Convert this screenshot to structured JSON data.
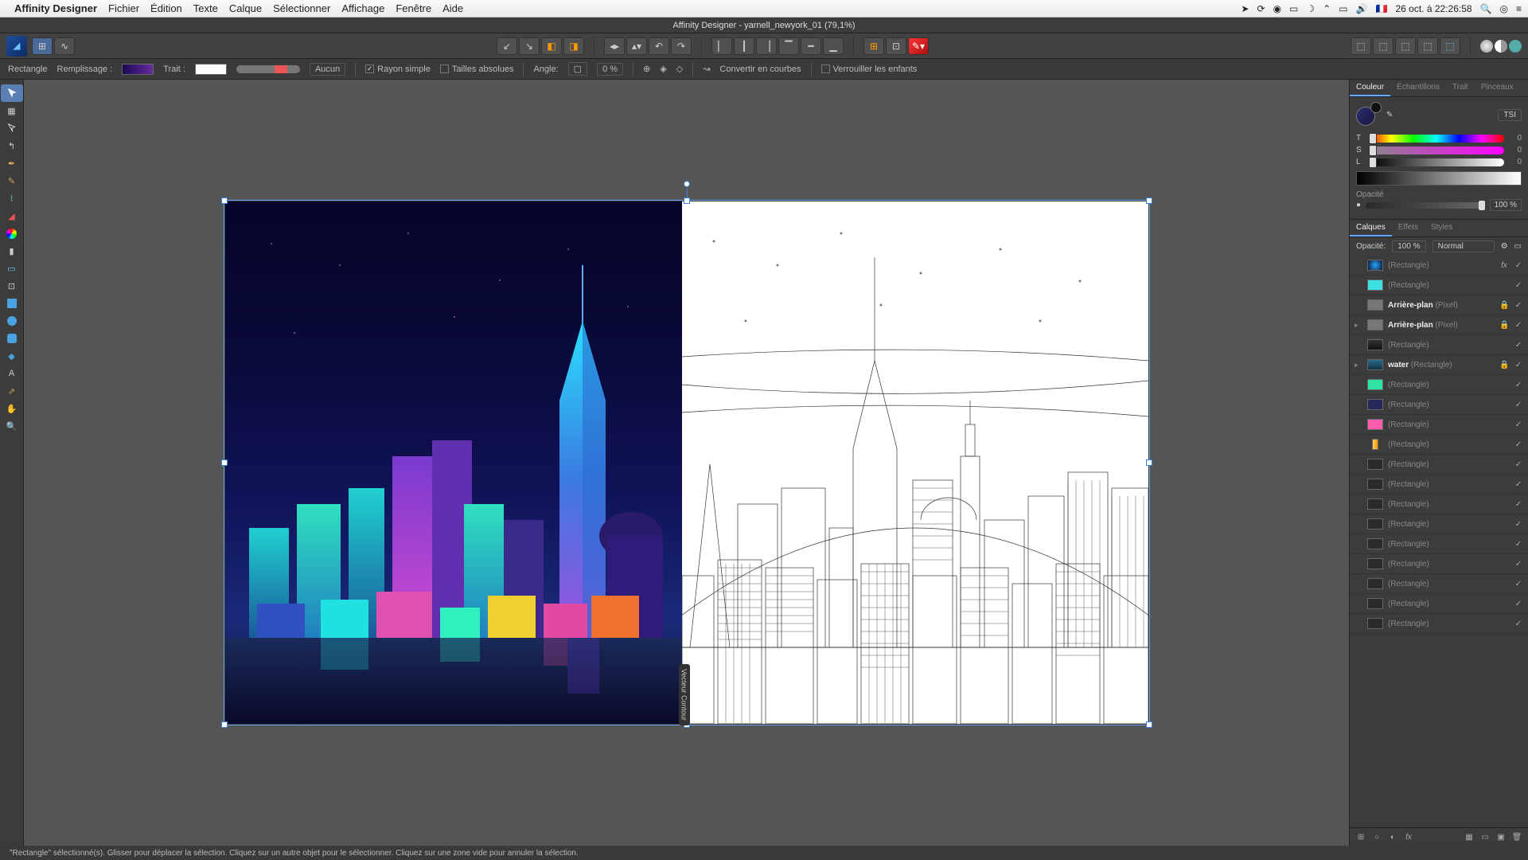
{
  "menubar": {
    "app": "Affinity Designer",
    "items": [
      "Fichier",
      "Édition",
      "Texte",
      "Calque",
      "Sélectionner",
      "Affichage",
      "Fenêtre",
      "Aide"
    ],
    "clock": "26 oct. à  22:26:58",
    "flag": "🇫🇷"
  },
  "doc_title": "Affinity Designer - yarnell_newyork_01 (79,1%)",
  "context": {
    "shape": "Rectangle",
    "fill_label": "Remplissage :",
    "stroke_label": "Trait :",
    "stroke_style": "Aucun",
    "simple_radius": "Rayon simple",
    "abs_sizes": "Tailles absolues",
    "angle_label": "Angle:",
    "angle_val": "0 %",
    "convert": "Convertir en courbes",
    "lock": "Verrouiller les enfants"
  },
  "color_panel": {
    "tabs": [
      "Couleur",
      "Échantillons",
      "Trait",
      "Pinceaux"
    ],
    "mode": "TSI",
    "t": "0",
    "s": "0",
    "l": "0",
    "opacity_label": "Opacité",
    "opacity": "100 %"
  },
  "layers_panel": {
    "tabs": [
      "Calques",
      "Effets",
      "Styles"
    ],
    "opacity_label": "Opacité:",
    "opacity_val": "100 %",
    "blend": "Normal"
  },
  "layers": [
    {
      "thumb": "radial-gradient(circle,#2af,#113)",
      "name": "(Rectangle)",
      "fx": true,
      "check": true
    },
    {
      "thumb": "#3de0e0",
      "name": "(Rectangle)",
      "check": true
    },
    {
      "thumb": "#777",
      "bold": "Arrière-plan",
      "paren": "(Pixel)",
      "lock": true,
      "check": true
    },
    {
      "thumb": "#777",
      "bold": "Arrière-plan",
      "paren": "(Pixel)",
      "lock": true,
      "check": true,
      "expand": true
    },
    {
      "thumb": "linear-gradient(#333,#111)",
      "name": "(Rectangle)",
      "check": true
    },
    {
      "thumb": "linear-gradient(#2a6a8a,#134)",
      "bold": "water",
      "paren": "(Rectangle)",
      "lock": true,
      "check": true,
      "expand": true
    },
    {
      "thumb": "#2ee6a2",
      "name": "(Rectangle)",
      "check": true
    },
    {
      "thumb": "#28285a",
      "name": "(Rectangle)",
      "check": true
    },
    {
      "thumb": "#ff5cae",
      "name": "(Rectangle)",
      "check": true
    },
    {
      "thumb": "linear-gradient(90deg,#fc6,#f90)",
      "name": "(Rectangle)",
      "check": true,
      "narrow": true
    },
    {
      "thumb": "#2a2a2a",
      "name": "(Rectangle)",
      "check": true
    },
    {
      "thumb": "#2a2a2a",
      "name": "(Rectangle)",
      "check": true
    },
    {
      "thumb": "#2a2a2a",
      "name": "(Rectangle)",
      "check": true
    },
    {
      "thumb": "#2a2a2a",
      "name": "(Rectangle)",
      "check": true
    },
    {
      "thumb": "#2a2a2a",
      "name": "(Rectangle)",
      "check": true
    },
    {
      "thumb": "#2a2a2a",
      "name": "(Rectangle)",
      "check": true
    },
    {
      "thumb": "#2a2a2a",
      "name": "(Rectangle)",
      "check": true
    },
    {
      "thumb": "#2a2a2a",
      "name": "(Rectangle)",
      "check": true
    },
    {
      "thumb": "#2a2a2a",
      "name": "(Rectangle)",
      "check": true
    }
  ],
  "status": "\"Rectangle\" sélectionné(s). Glisser pour déplacer la sélection. Cliquez sur un autre objet pour le sélectionner. Cliquez sur une zone vide pour annuler la sélection.",
  "vec_tag": "Vecteur  Contour"
}
